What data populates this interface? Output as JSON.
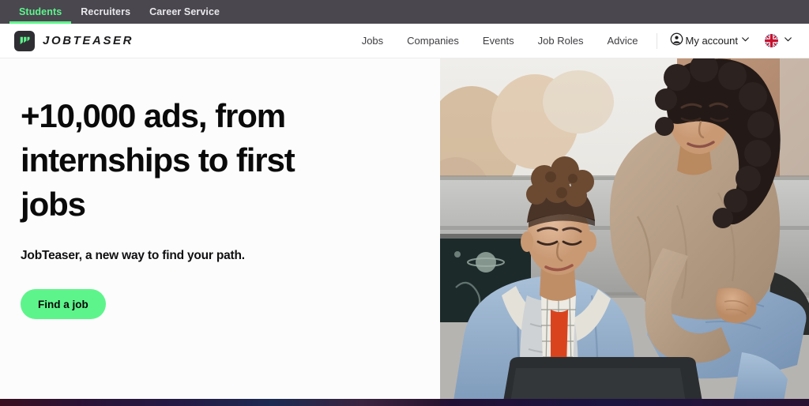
{
  "topbar": {
    "items": [
      {
        "label": "Students",
        "active": true
      },
      {
        "label": "Recruiters",
        "active": false
      },
      {
        "label": "Career Service",
        "active": false
      }
    ],
    "background": "#4a474f",
    "active_color": "#5df58b"
  },
  "header": {
    "logo": {
      "mark_icon": "jobteaser-logo-icon",
      "wordmark": "JOBTEASER",
      "mark_background": "#2f2f33",
      "mark_color": "#5df58b"
    },
    "nav_links": [
      {
        "label": "Jobs"
      },
      {
        "label": "Companies"
      },
      {
        "label": "Events"
      },
      {
        "label": "Job Roles"
      },
      {
        "label": "Advice"
      }
    ],
    "account": {
      "icon": "user-circle-icon",
      "label": "My account",
      "chevron": "chevron-down-icon"
    },
    "language": {
      "flag": "uk-flag-icon",
      "chevron": "chevron-down-icon"
    }
  },
  "hero": {
    "title": "+10,000 ads, from internships to first jobs",
    "subtitle": "JobTeaser, a new way to find your path.",
    "cta_label": "Find a job",
    "cta_color": "#5df58b",
    "image_alt": "Two students outdoors, one working on a laptop while the other leans over to look"
  }
}
